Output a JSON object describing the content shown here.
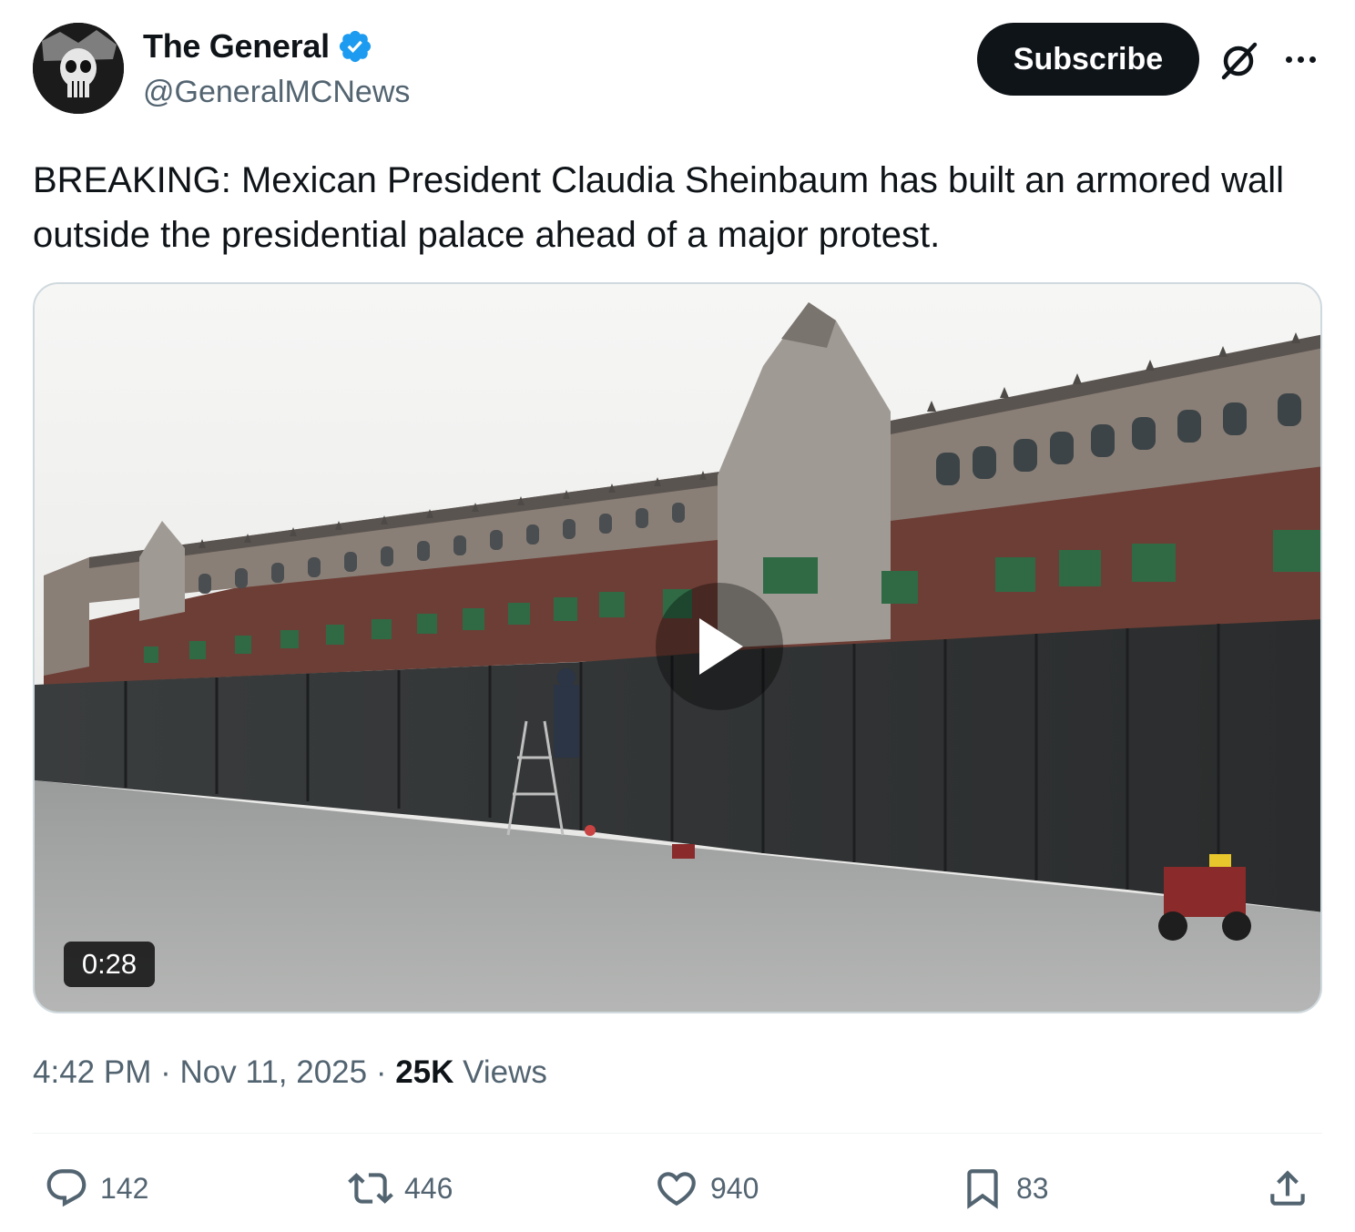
{
  "author": {
    "display_name": "The General",
    "handle": "@GeneralMCNews",
    "verified_badge_icon": "verified-check-icon",
    "badge_color": "#1d9bf0"
  },
  "header": {
    "subscribe_label": "Subscribe",
    "grok_icon": "grok-icon",
    "more_icon": "more-options-icon"
  },
  "tweet": {
    "text": "BREAKING: Mexican President Claudia Sheinbaum has built an armored wall outside the presidential palace ahead of a major protest."
  },
  "media": {
    "duration": "0:28",
    "play_icon": "play-icon"
  },
  "meta": {
    "time": "4:42 PM",
    "separator": "·",
    "date": "Nov 11, 2025",
    "views_count": "25K",
    "views_label": "Views"
  },
  "actions": {
    "replies": "142",
    "reposts": "446",
    "likes": "940",
    "bookmarks": "83"
  },
  "colors": {
    "text_primary": "#0f1419",
    "text_secondary": "#536471",
    "accent": "#1d9bf0"
  }
}
